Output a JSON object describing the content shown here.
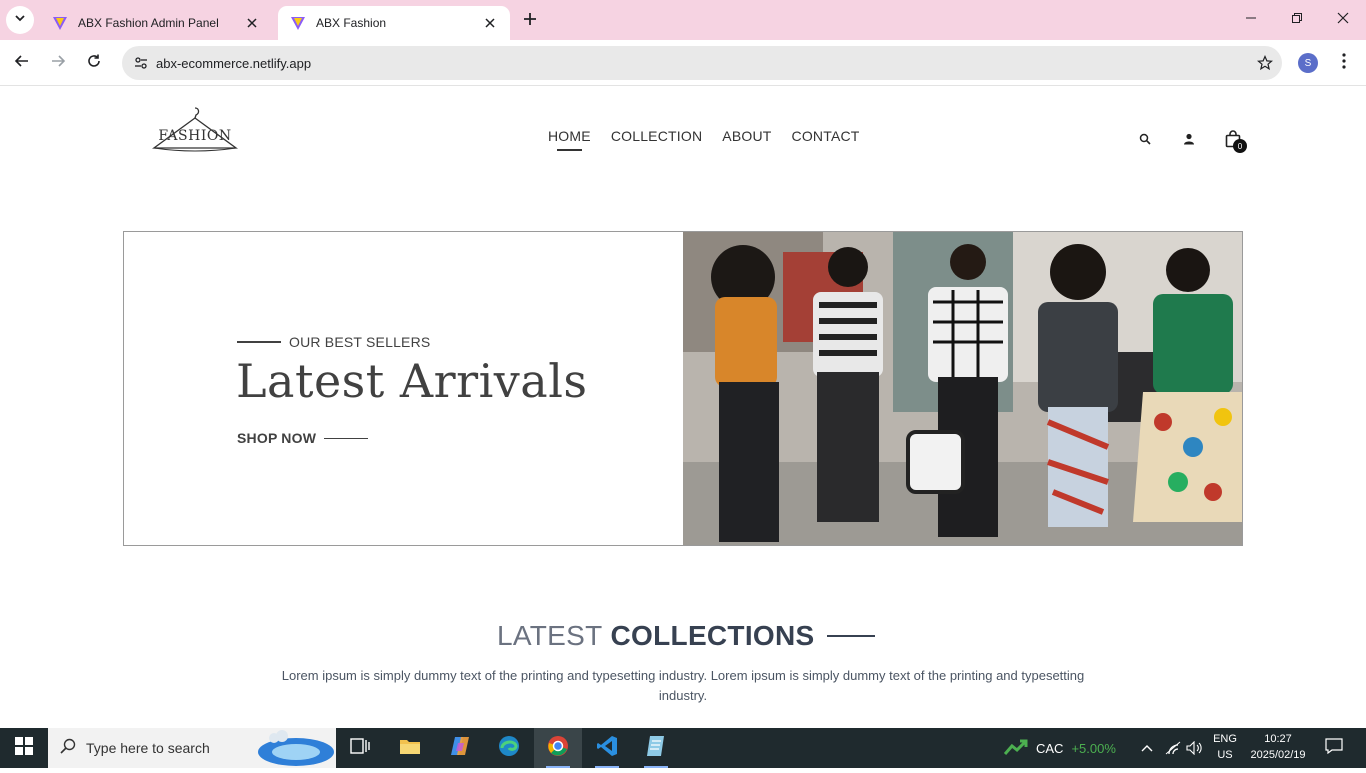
{
  "browser": {
    "tabs": [
      {
        "title": "ABX Fashion Admin Panel",
        "active": false
      },
      {
        "title": "ABX Fashion",
        "active": true
      }
    ],
    "url": "abx-ecommerce.netlify.app",
    "profile_initial": "S"
  },
  "site": {
    "logo_text": "FASHION",
    "nav": [
      {
        "label": "HOME",
        "active": true
      },
      {
        "label": "COLLECTION",
        "active": false
      },
      {
        "label": "ABOUT",
        "active": false
      },
      {
        "label": "CONTACT",
        "active": false
      }
    ],
    "cart_count": "0"
  },
  "hero": {
    "eyebrow": "OUR BEST SELLERS",
    "title": "Latest Arrivals",
    "cta": "SHOP NOW"
  },
  "collections": {
    "title_light": "LATEST",
    "title_bold": "COLLECTIONS",
    "description": "Lorem ipsum is simply dummy text of the printing and typesetting industry. Lorem ipsum is simply dummy text of the printing and typesetting industry."
  },
  "taskbar": {
    "search_placeholder": "Type here to search",
    "stock_name": "CAC",
    "stock_change": "+5.00%",
    "lang_line1": "ENG",
    "lang_line2": "US",
    "time": "10:27",
    "date": "2025/02/19"
  }
}
